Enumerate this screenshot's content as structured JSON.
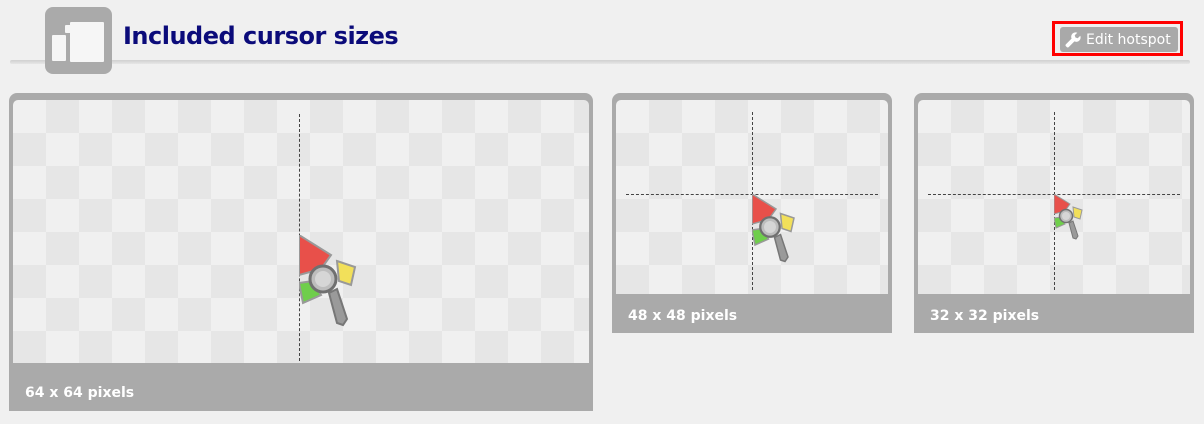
{
  "header": {
    "title": "Included cursor sizes",
    "edit_hotspot_label": "Edit hotspot",
    "title_color": "#0b0b7a",
    "highlight_color": "#ff0000"
  },
  "previews": [
    {
      "label": "64 x 64 pixels",
      "icon": "magnifier-pointer-icon"
    },
    {
      "label": "48 x 48 pixels",
      "icon": "magnifier-pointer-icon"
    },
    {
      "label": "32 x 32 pixels",
      "icon": "magnifier-pointer-icon"
    }
  ]
}
